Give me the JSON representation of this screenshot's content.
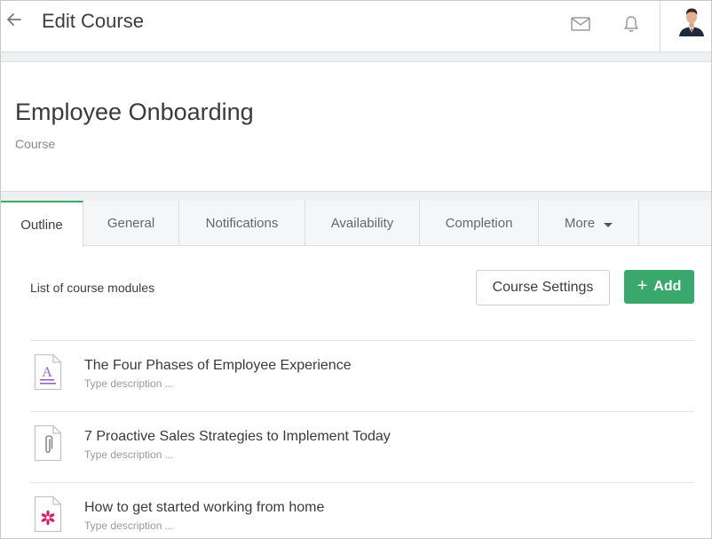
{
  "header": {
    "title": "Edit Course"
  },
  "course": {
    "name": "Employee Onboarding",
    "type": "Course"
  },
  "tabs": [
    {
      "label": "Outline",
      "active": true
    },
    {
      "label": "General"
    },
    {
      "label": "Notifications"
    },
    {
      "label": "Availability"
    },
    {
      "label": "Completion"
    },
    {
      "label": "More"
    }
  ],
  "modules_section": {
    "label": "List of course modules",
    "settings_label": "Course Settings",
    "add_label": "Add"
  },
  "modules": [
    {
      "title": "The Four Phases of Employee Experience",
      "description": "Type description ...",
      "icon": "text-document-icon"
    },
    {
      "title": "7 Proactive Sales Strategies to Implement Today",
      "description": "Type description ...",
      "icon": "attachment-icon"
    },
    {
      "title": "How to get started working from home",
      "description": "Type description ...",
      "icon": "integration-icon"
    }
  ],
  "colors": {
    "accent": "#3aa76d",
    "text_icon": "#9b5fc0",
    "integration_icon": "#d81b60"
  }
}
